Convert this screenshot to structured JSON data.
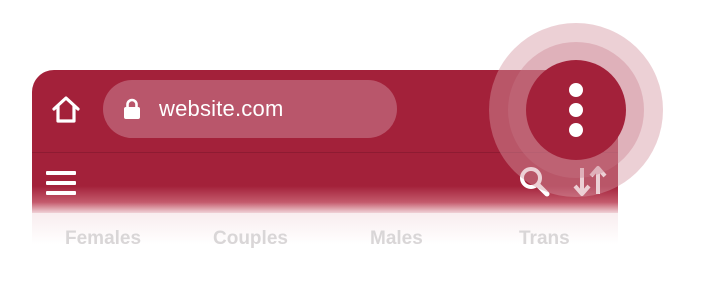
{
  "address_bar": {
    "url": "website.com"
  },
  "icons": {
    "home": "home-icon",
    "lock": "lock-icon",
    "menu": "hamburger-menu-icon",
    "search": "search-icon",
    "sort": "sort-arrows-icon",
    "more": "more-vertical-icon"
  },
  "tabs": [
    {
      "label": "Females"
    },
    {
      "label": "Couples"
    },
    {
      "label": "Males"
    },
    {
      "label": "Trans"
    }
  ],
  "colors": {
    "brand": "#a3213a",
    "url_pill": "#b9566b",
    "highlight_ring": "#e8bcc5"
  }
}
